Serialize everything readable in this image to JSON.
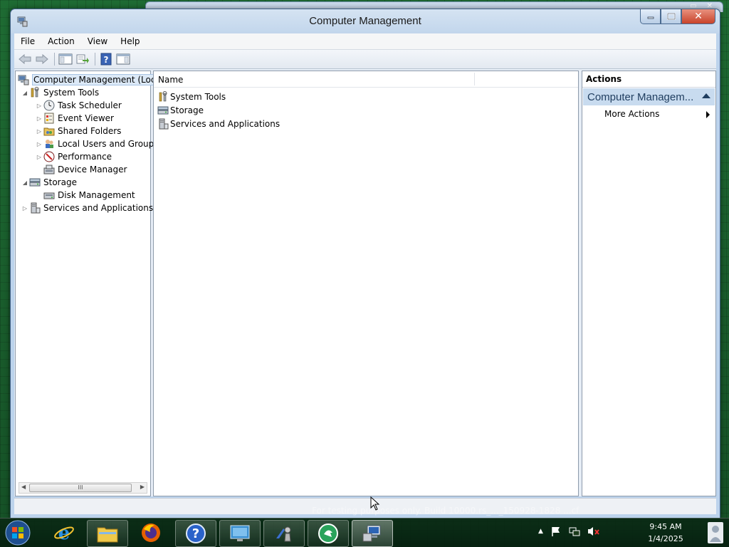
{
  "window": {
    "title": "Computer Management"
  },
  "menubar": {
    "items": [
      "File",
      "Action",
      "View",
      "Help"
    ]
  },
  "toolbar": {
    "buttons": [
      "back-icon",
      "forward-icon",
      "show-hide-console-tree-icon",
      "export-list-icon",
      "help-icon",
      "show-hide-action-pane-icon"
    ]
  },
  "tree": {
    "root": "Computer Management (Local",
    "system_tools": "System Tools",
    "task_scheduler": "Task Scheduler",
    "event_viewer": "Event Viewer",
    "shared_folders": "Shared Folders",
    "local_users": "Local Users and Groups",
    "performance": "Performance",
    "device_manager": "Device Manager",
    "storage": "Storage",
    "disk_management": "Disk Management",
    "services_apps": "Services and Applications",
    "scroll_grip": "III"
  },
  "list": {
    "column_name": "Name",
    "items": [
      "System Tools",
      "Storage",
      "Services and Applications"
    ]
  },
  "actions": {
    "header": "Actions",
    "section": "Computer Managem...",
    "more_actions": "More Actions"
  },
  "taskbar": {
    "apps": [
      "internet-explorer-icon",
      "file-explorer-icon",
      "firefox-icon",
      "help-icon",
      "remote-desktop-icon",
      "chess-icon",
      "app-icon",
      "computer-management-icon"
    ],
    "time": "9:45 AM",
    "date": "1/4/2025"
  },
  "watermark": "For testing purposes only. Build 10000.rs_..._150928-1828 ...cf"
}
